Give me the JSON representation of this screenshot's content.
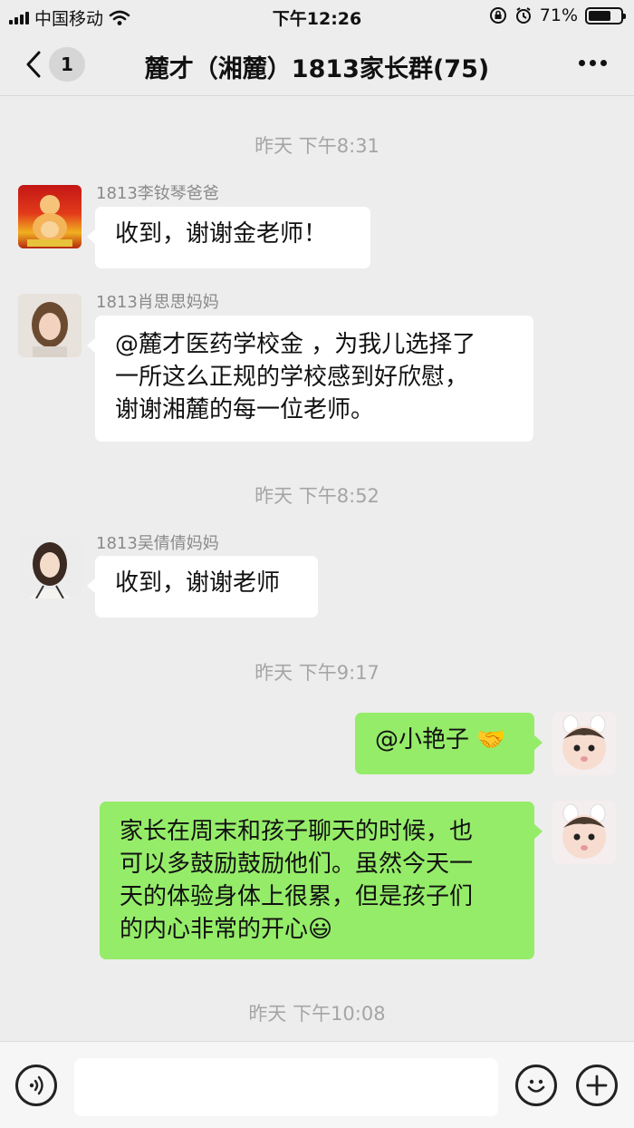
{
  "status_bar": {
    "carrier": "中国移动",
    "time": "下午12:26",
    "battery": "71%",
    "battery_level": 0.71
  },
  "header": {
    "unread_count": "1",
    "title": "麓才（湘麓）1813家长群(75)"
  },
  "messages": [
    {
      "type": "timestamp",
      "text": "昨天 下午8:31"
    },
    {
      "type": "incoming",
      "sender": "1813李钕琴爸爸",
      "text": "收到，谢谢金老师！",
      "avatar_icon": "buddha-avatar-icon"
    },
    {
      "type": "incoming",
      "sender": "1813肖思思妈妈",
      "lines": [
        "@麓才医药学校金 ，为我儿选择了",
        "一所这么正规的学校感到好欣慰，",
        "谢谢湘麓的每一位老师。"
      ],
      "avatar_icon": "woman-avatar-icon"
    },
    {
      "type": "timestamp",
      "text": "昨天 下午8:52"
    },
    {
      "type": "incoming",
      "sender": "1813吴倩倩妈妈",
      "text": "收到，谢谢老师",
      "avatar_icon": "woman-avatar-icon"
    },
    {
      "type": "timestamp",
      "text": "昨天 下午9:17"
    },
    {
      "type": "outgoing",
      "text": "@小艳子 ",
      "emoji": "🤝",
      "avatar_icon": "baby-avatar-icon"
    },
    {
      "type": "outgoing",
      "lines": [
        "家长在周末和孩子聊天的时候，也",
        "可以多鼓励鼓励他们。虽然今天一",
        "天的体验身体上很累，但是孩子们",
        "的内心非常的开心"
      ],
      "emoji": "😃",
      "avatar_icon": "baby-avatar-icon"
    },
    {
      "type": "timestamp",
      "text": "昨天 下午10:08"
    }
  ],
  "input_bar": {
    "voice_icon": "voice-icon",
    "emoji_icon": "smiley-icon",
    "add_icon": "plus-icon"
  },
  "colors": {
    "background": "#ededed",
    "outgoing_bubble": "#95ec69",
    "incoming_bubble": "#ffffff",
    "timestamp": "#a5a5a5"
  }
}
